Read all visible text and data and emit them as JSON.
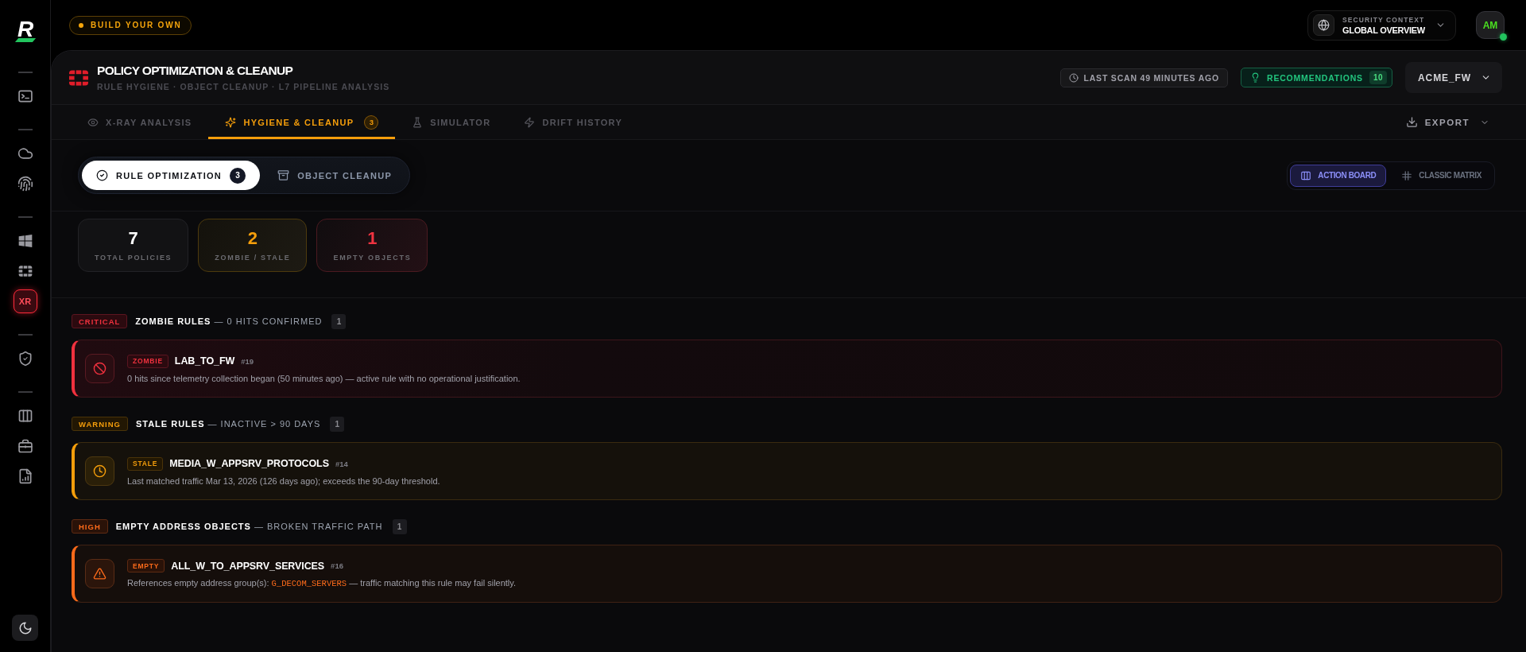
{
  "sidebar": {
    "logo": "R",
    "groups": [
      {
        "items": [
          {
            "selected": false
          }
        ]
      },
      {
        "items": [
          {
            "selected": false
          },
          {
            "selected": false
          }
        ]
      },
      {
        "items": [
          {
            "selected": false
          },
          {
            "selected": false
          },
          {
            "label": "XR",
            "selected": true
          }
        ]
      },
      {
        "items": [
          {
            "selected": false
          }
        ]
      },
      {
        "items": [
          {
            "selected": false
          },
          {
            "selected": false
          },
          {
            "selected": false
          }
        ]
      }
    ]
  },
  "top_bar": {
    "build_button": "BUILD YOUR OWN",
    "security_context": {
      "label": "SECURITY CONTEXT",
      "value": "GLOBAL OVERVIEW"
    },
    "user": {
      "initials": "AM",
      "online": true
    }
  },
  "page_header": {
    "title": "POLICY OPTIMIZATION & CLEANUP",
    "subtitle": "RULE HYGIENE · OBJECT CLEANUP · L7 PIPELINE ANALYSIS",
    "last_scan": "LAST SCAN 49 MINUTES AGO",
    "recommendations": {
      "label": "RECOMMENDATIONS",
      "count": "10"
    },
    "device": "ACME_FW"
  },
  "tabs": [
    {
      "label": "X-RAY ANALYSIS",
      "selected": false
    },
    {
      "label": "HYGIENE & CLEANUP",
      "badge": "3",
      "selected": true
    },
    {
      "label": "SIMULATOR",
      "selected": false
    },
    {
      "label": "DRIFT HISTORY",
      "selected": false
    }
  ],
  "export": "EXPORT",
  "modes": [
    {
      "label": "RULE OPTIMIZATION",
      "badge": "3",
      "selected": true
    },
    {
      "label": "OBJECT CLEANUP",
      "selected": false
    }
  ],
  "views": [
    {
      "label": "ACTION BOARD",
      "selected": true
    },
    {
      "label": "CLASSIC MATRIX",
      "selected": false
    }
  ],
  "stats": [
    {
      "kind": "neutral",
      "value": "7",
      "label": "TOTAL POLICIES"
    },
    {
      "kind": "warning",
      "value": "2",
      "label": "ZOMBIE / STALE"
    },
    {
      "kind": "critical",
      "value": "1",
      "label": "EMPTY OBJECTS"
    }
  ],
  "sections": [
    {
      "kind": "critical",
      "severity": "CRITICAL",
      "title": "**ZOMBIE RULES** — 0 HITS CONFIRMED",
      "count": "1",
      "findings": [
        {
          "tag": "ZOMBIE",
          "name": "LAB_TO_FW",
          "number": "#19",
          "description": "0 hits since telemetry collection began (50 minutes ago) — active rule with no operational justification."
        }
      ]
    },
    {
      "kind": "warning",
      "severity": "WARNING",
      "title": "**STALE RULES** — INACTIVE > 90 DAYS",
      "count": "1",
      "findings": [
        {
          "tag": "STALE",
          "name": "MEDIA_W_APPSRV_PROTOCOLS",
          "number": "#14",
          "description": "Last matched traffic Mar 13, 2026 (126 days ago); exceeds the 90-day threshold."
        }
      ]
    },
    {
      "kind": "high",
      "severity": "HIGH",
      "title": "**EMPTY ADDRESS OBJECTS** — BROKEN TRAFFIC PATH",
      "count": "1",
      "findings": [
        {
          "tag": "EMPTY",
          "name": "ALL_W_TO_APPSRV_SERVICES",
          "number": "#16",
          "description": "References empty address group(s): **G_DECOM_SERVERS** — traffic matching this rule may fail silently."
        }
      ]
    }
  ]
}
